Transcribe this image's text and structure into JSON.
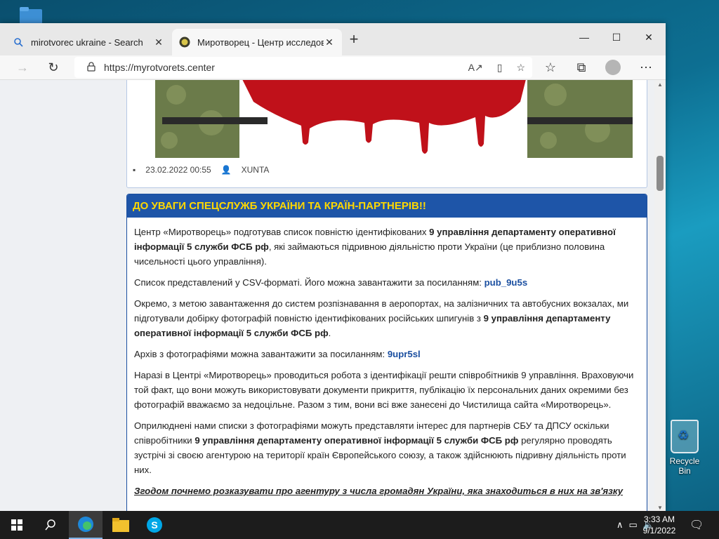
{
  "desktop": {
    "recycle_bin": "Recycle Bin"
  },
  "tabs": [
    {
      "title": "mirotvorec ukraine - Search",
      "icon": "search-icon"
    },
    {
      "title": "Миротворец - Центр исследов",
      "icon": "site-favicon"
    }
  ],
  "address": {
    "url": "https://myrotvorets.center"
  },
  "post1": {
    "date": "23.02.2022 00:55",
    "author": "XUNTA"
  },
  "post2": {
    "title": "ДО УВАГИ СПЕЦСЛУЖБ УКРАЇНИ ТА КРАЇН-ПАРТНЕРІВ!!",
    "p1_a": "Центр «Миротворець» подготував список повністю ідентифікованих ",
    "p1_b": "9 управління департаменту оперативної інформації 5 служби ФСБ рф",
    "p1_c": ", які займаються підривною діяльністю проти України (це приблизно половина чисельності цього управління).",
    "p2_a": "Список представлений у CSV-форматі. Його можна завантажити за посиланням: ",
    "p2_link": "pub_9u5s",
    "p3_a": "Окремо, з метою завантаження до систем розпізнавання в аеропортах, на залізничних та автобусних вокзалах, ми підготували добірку фотографій повністю ідентифікованих російських шпигунів з ",
    "p3_b": "9 управління департаменту оперативної інформації 5 служби ФСБ рф",
    "p3_c": ".",
    "p4_a": "Архів з фотографіями можна завантажити за посиланням: ",
    "p4_link": "9upr5sl",
    "p5": "Наразі в Центрі «Миротворець» проводиться робота з ідентифікації решти співробітників 9 управління. Враховуючи той факт, що вони можуть використовувати документи прикриття, публікацію їх персональних даних окремими без фотографій вважаємо за недоцільне. Разом з тим, вони всі вже занесені до Чистилища сайта «Миротворець».",
    "p6_a": "Оприлюднені нами списки з фотографіями можуть представляти інтерес для партнерів СБУ та ДПСУ оскільки співробітники ",
    "p6_b": "9 управління департаменту оперативної інформації 5 служби ФСБ рф",
    "p6_c": " регулярно проводять зустрічі зі своєю агентурою на території країн Європейського союзу, а також здійснюють підривну діяльність проти них.",
    "p7": "Згодом почнемо розказувати про агентуру з числа громадян України, яка знаходиться в них на зв'язку"
  },
  "taskbar": {
    "time": "3:33 AM",
    "date": "9/1/2022"
  },
  "colors": {
    "accent_blue": "#1e55a8",
    "title_yellow": "#ffd800",
    "link": "#1b4fa0"
  }
}
